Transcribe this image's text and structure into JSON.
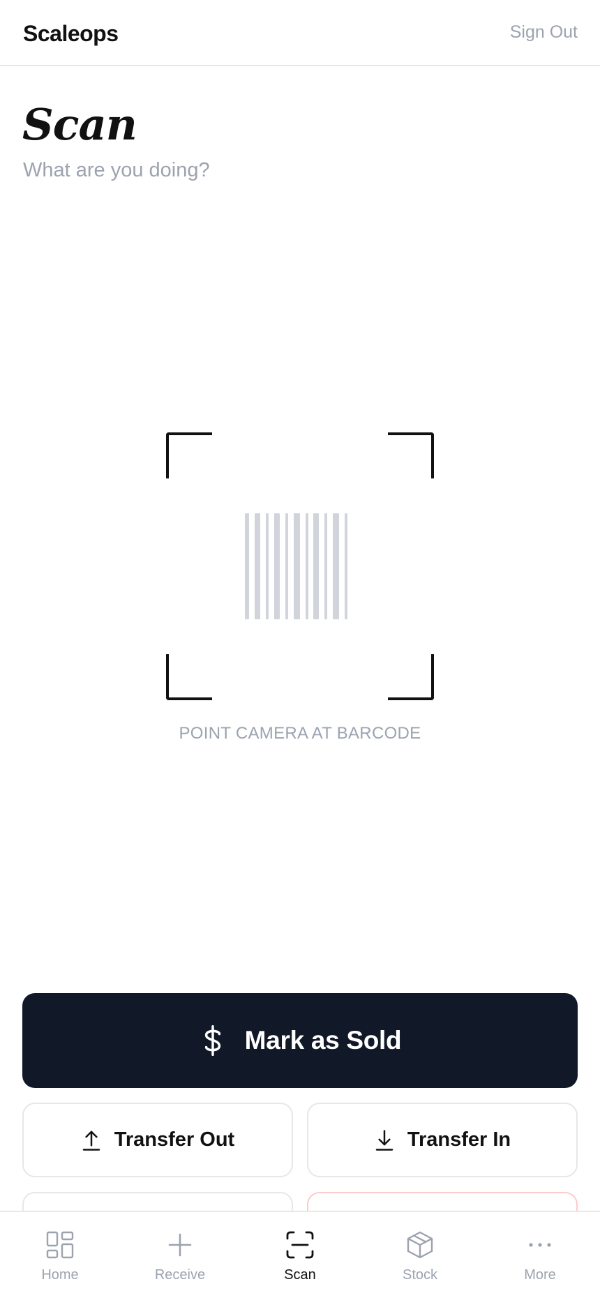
{
  "header": {
    "brand": "Scaleops",
    "sign_out": "Sign Out"
  },
  "page": {
    "title": "Scan",
    "subtitle": "What are you doing?"
  },
  "scanner": {
    "hint": "POINT CAMERA AT BARCODE",
    "icon": "barcode-icon"
  },
  "actions": {
    "primary": {
      "label": "Mark as Sold",
      "icon": "dollar-icon"
    },
    "transfer_out": {
      "label": "Transfer Out",
      "icon": "arrow-up-icon"
    },
    "transfer_in": {
      "label": "Transfer In",
      "icon": "arrow-down-icon"
    }
  },
  "nav": {
    "items": [
      {
        "label": "Home",
        "icon": "grid-icon",
        "active": false
      },
      {
        "label": "Receive",
        "icon": "plus-icon",
        "active": false
      },
      {
        "label": "Scan",
        "icon": "scan-icon",
        "active": true
      },
      {
        "label": "Stock",
        "icon": "box-icon",
        "active": false
      },
      {
        "label": "More",
        "icon": "more-icon",
        "active": false
      }
    ]
  },
  "colors": {
    "primary": "#111827",
    "muted_text": "#9ca3af",
    "border": "#e5e7eb",
    "danger_border": "#fecaca"
  }
}
